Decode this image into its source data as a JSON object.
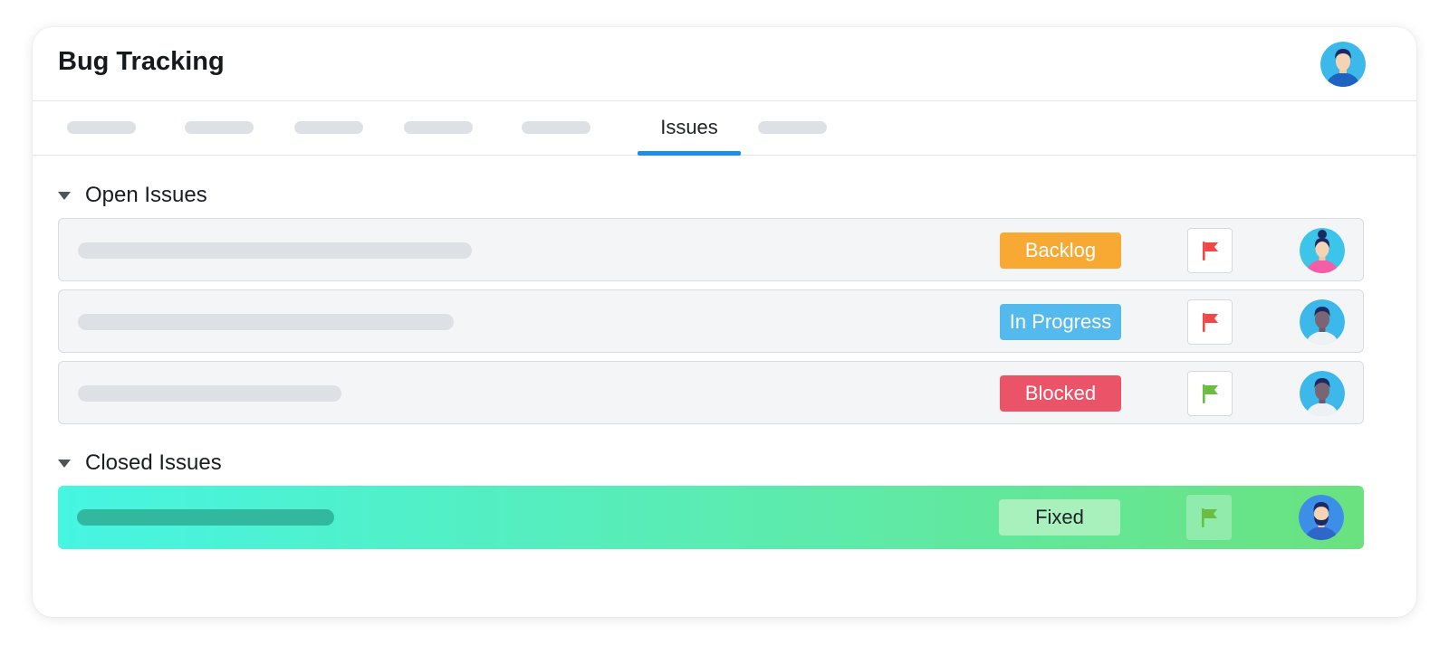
{
  "header": {
    "title": "Bug Tracking",
    "user_avatar": "user-avatar-icon"
  },
  "tabs": {
    "active_label": "Issues",
    "active_color": "#1e8bef",
    "placeholder_count": 6
  },
  "sections": {
    "open": {
      "label": "Open Issues"
    },
    "closed": {
      "label": "Closed Issues"
    }
  },
  "issues": {
    "open": [
      {
        "status": "Backlog",
        "status_color": "#f8a933",
        "flag_color": "#f04848",
        "assignee": "woman-avatar-icon"
      },
      {
        "status": "In Progress",
        "status_color": "#54b9ec",
        "flag_color": "#f04848",
        "assignee": "man-avatar-icon"
      },
      {
        "status": "Blocked",
        "status_color": "#ea5368",
        "flag_color": "#6bbd3f",
        "assignee": "man-avatar-icon"
      }
    ],
    "closed": [
      {
        "status": "Fixed",
        "status_color": "#a8f0bc",
        "flag_color": "#6bbd3f",
        "assignee": "bearded-man-avatar-icon"
      }
    ]
  }
}
